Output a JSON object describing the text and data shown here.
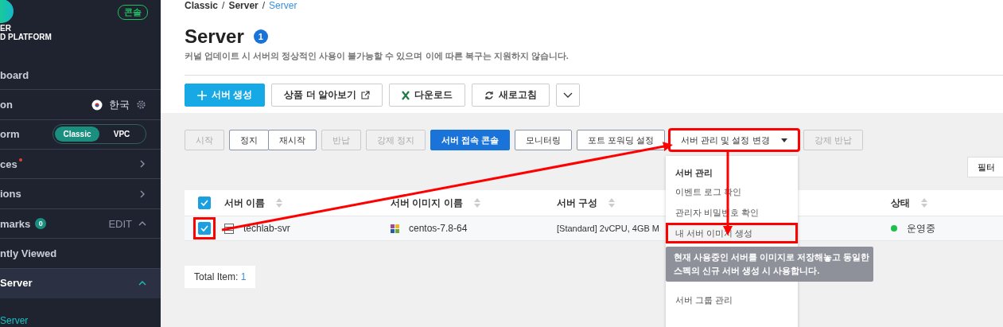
{
  "sidebar": {
    "logo_lines": [
      "ER",
      "D PLATFORM"
    ],
    "console_badge": "콘솔",
    "items": [
      {
        "kind": "link",
        "label": "board"
      },
      {
        "kind": "region",
        "label": "on",
        "value": "한국"
      },
      {
        "kind": "platform",
        "label": "orm",
        "options": [
          {
            "label": "Classic",
            "selected": true
          },
          {
            "label": "VPC",
            "selected": false
          }
        ]
      },
      {
        "kind": "nav",
        "label": "ces",
        "new": true
      },
      {
        "kind": "nav",
        "label": "ions",
        "new": false
      },
      {
        "kind": "bookmarks",
        "label": "marks",
        "count": "0",
        "action": "EDIT",
        "expanded": true
      },
      {
        "kind": "link",
        "label": "ntly Viewed"
      },
      {
        "kind": "group",
        "label": "Server",
        "expanded": true
      },
      {
        "kind": "sub",
        "label": "Server"
      }
    ]
  },
  "breadcrumb": {
    "separator": "/",
    "items": [
      {
        "label": "Classic",
        "current": false
      },
      {
        "label": "Server",
        "current": false
      },
      {
        "label": "Server",
        "current": true
      }
    ]
  },
  "title": "Server",
  "title_badge": "1",
  "description": "커널 업데이트 시 서버의 정상적인 사용이 불가능할 수 있으며 이에 따른 복구는 지원하지 않습니다.",
  "toolbar": [
    {
      "kind": "primary",
      "label": "서버 생성"
    },
    {
      "kind": "external",
      "label": "상품 더 알아보기"
    },
    {
      "kind": "excel",
      "label": "다운로드"
    },
    {
      "kind": "refresh",
      "label": "새로고침"
    },
    {
      "kind": "more"
    }
  ],
  "actions": [
    {
      "kind": "plain",
      "label": "시작",
      "disabled": true,
      "highlighted": false
    },
    {
      "kind": "segment",
      "label": "정지",
      "disabled": false,
      "highlighted": false
    },
    {
      "kind": "segment",
      "label": "재시작",
      "disabled": false,
      "highlighted": false
    },
    {
      "kind": "plain",
      "label": "반납",
      "disabled": true,
      "highlighted": false
    },
    {
      "kind": "plain",
      "label": "강제 정지",
      "disabled": true,
      "highlighted": false
    },
    {
      "kind": "primary",
      "label": "서버 접속 콘솔",
      "disabled": false,
      "highlighted": false
    },
    {
      "kind": "plain",
      "label": "모니터링",
      "disabled": false,
      "highlighted": false
    },
    {
      "kind": "plain",
      "label": "포트 포워딩 설정",
      "disabled": false,
      "highlighted": false
    },
    {
      "kind": "dropdown",
      "label": "서버 관리 및 설정 변경",
      "disabled": false,
      "highlighted": true
    },
    {
      "kind": "plain",
      "label": "강제 반납",
      "disabled": true,
      "highlighted": false
    }
  ],
  "filter_button": "필터",
  "table": {
    "all_checked": true,
    "columns": [
      {
        "label": "서버 이름"
      },
      {
        "label": "서버 이미지 이름"
      },
      {
        "label": "서버 구성"
      },
      {
        "label": "상태"
      }
    ],
    "rows": [
      {
        "checked": true,
        "highlighted": true,
        "name": "techlab-svr",
        "image": "centos-7.8-64",
        "config": "[Standard] 2vCPU, 4GB M",
        "status": "운영중"
      }
    ]
  },
  "total": {
    "label": "Total Item:",
    "count": "1"
  },
  "menu": {
    "header": "서버 관리",
    "items": [
      {
        "label": "이벤트 로그 확인",
        "highlighted": false
      },
      {
        "label": "관리자 비밀번호 확인",
        "highlighted": false
      },
      {
        "label": "내 서버 이미지 생성",
        "highlighted": true,
        "tooltip": [
          "현재 사용중인 서버를 이미지로 저장해놓고 동일한",
          "스펙의 신규 서버 생성 시 사용합니다."
        ]
      },
      {
        "label": "서버 그룹 관리",
        "highlighted": false
      }
    ]
  }
}
